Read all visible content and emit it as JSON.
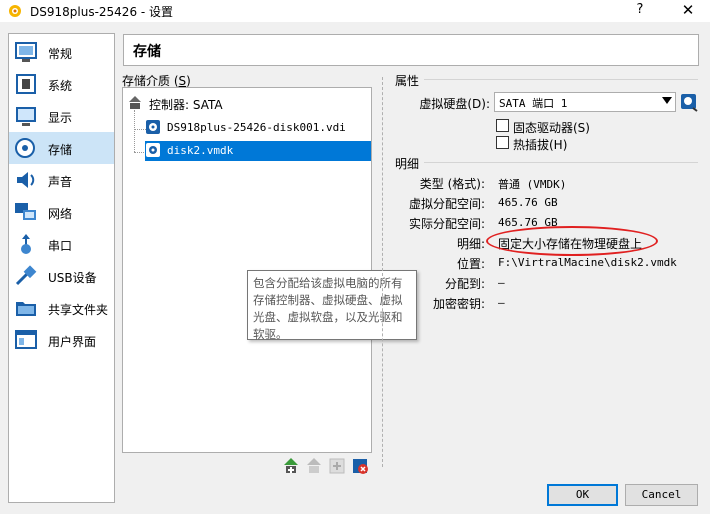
{
  "window": {
    "title": "DS918plus-25426 - 设置",
    "help_label": "?",
    "close_label": "✕"
  },
  "sidebar": {
    "items": [
      {
        "label": "常规",
        "icon": "general-icon"
      },
      {
        "label": "系统",
        "icon": "system-icon"
      },
      {
        "label": "显示",
        "icon": "display-icon"
      },
      {
        "label": "存储",
        "icon": "storage-icon",
        "selected": true
      },
      {
        "label": "声音",
        "icon": "audio-icon"
      },
      {
        "label": "网络",
        "icon": "network-icon"
      },
      {
        "label": "串口",
        "icon": "serial-port-icon"
      },
      {
        "label": "USB设备",
        "icon": "usb-icon"
      },
      {
        "label": "共享文件夹",
        "icon": "shared-folder-icon"
      },
      {
        "label": "用户界面",
        "icon": "user-interface-icon"
      }
    ]
  },
  "page": {
    "title": "存储"
  },
  "storage_tree": {
    "label_pre": "存储介质 (",
    "label_key": "S",
    "label_post": ")",
    "controller": "控制器: SATA",
    "disks": [
      "DS918plus-25426-disk001.vdi",
      "disk2.vmdk"
    ],
    "selected": "disk2.vmdk"
  },
  "tooltip": {
    "text": "包含分配给该虚拟电脑的所有存储控制器、虚拟硬盘、虚拟光盘、虚拟软盘，以及光驱和软驱。"
  },
  "attributes": {
    "section_title": "属性",
    "hard_disk_label": "虚拟硬盘(D):",
    "hard_disk_value": "SATA 端口 1",
    "ssd_label": "固态驱动器(S)",
    "hotplug_label": "热插拔(H)",
    "ssd_checked": false,
    "hotplug_checked": false
  },
  "details": {
    "section_title": "明细",
    "rows": [
      {
        "label": "类型 (格式):",
        "value": "普通  (VMDK)"
      },
      {
        "label": "虚拟分配空间:",
        "value": "465.76  GB"
      },
      {
        "label": "实际分配空间:",
        "value": "465.76  GB"
      },
      {
        "label": "明细:",
        "value": "固定大小存储在物理硬盘上"
      },
      {
        "label": "位置:",
        "value": "F:\\VirtralMacine\\disk2.vmdk"
      },
      {
        "label": "分配到:",
        "value": "—"
      },
      {
        "label": "加密密钥:",
        "value": "—"
      }
    ]
  },
  "buttons": {
    "ok": "OK",
    "cancel": "Cancel"
  },
  "colors": {
    "selection": "#0078d7",
    "sidebar_selected": "#cce4f7",
    "annotation": "#e02020"
  }
}
